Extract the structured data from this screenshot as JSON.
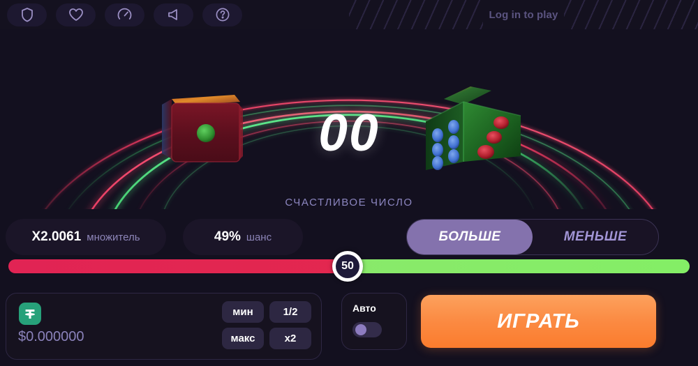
{
  "colors": {
    "background": "#13101f",
    "panel": "#1b1528",
    "accent_purple": "#8472ad",
    "accent_orange": "#fb8a42",
    "track_low": "#e12454",
    "track_high": "#86ec68",
    "coin_green": "#27a17a",
    "muted_text": "#8d85b8"
  },
  "topbar": {
    "icons": [
      {
        "name": "shield-icon",
        "label": "shield"
      },
      {
        "name": "heart-icon",
        "label": "heart"
      },
      {
        "name": "gauge-icon",
        "label": "speedometer"
      },
      {
        "name": "volume-icon",
        "label": "sound"
      },
      {
        "name": "help-icon",
        "label": "help"
      }
    ],
    "login_text": "Log in to play"
  },
  "stage": {
    "lucky_number": "00",
    "lucky_label": "СЧАСТЛИВОЕ ЧИСЛО",
    "dice": [
      {
        "name": "die-red",
        "color": "#6b1220",
        "face_value": "1",
        "pip_color": "#2f8f2f"
      },
      {
        "name": "die-green",
        "color": "#1f6b23",
        "face_value": "3",
        "pip_color": "#c02030"
      }
    ]
  },
  "stats": {
    "multiplier_value": "X2.0061",
    "multiplier_unit": "множитель",
    "chance_value": "49%",
    "chance_unit": "шанс"
  },
  "direction_toggle": {
    "options": [
      {
        "label": "БОЛЬШЕ",
        "active": true
      },
      {
        "label": "МЕНЬШЕ",
        "active": false
      }
    ],
    "over_label": "БОЛЬШЕ",
    "under_label": "МЕНЬШЕ"
  },
  "slider": {
    "value": "50",
    "min": 0,
    "max": 100,
    "percent": 50
  },
  "bet": {
    "currency_symbol": "₮",
    "amount": "$0.000000",
    "quick_buttons": [
      "мин",
      "1/2",
      "макс",
      "x2"
    ],
    "min_label": "мин",
    "half_label": "1/2",
    "max_label": "макс",
    "double_label": "x2"
  },
  "auto": {
    "label": "Авто",
    "enabled": false
  },
  "play": {
    "label": "ИГРАТЬ"
  }
}
